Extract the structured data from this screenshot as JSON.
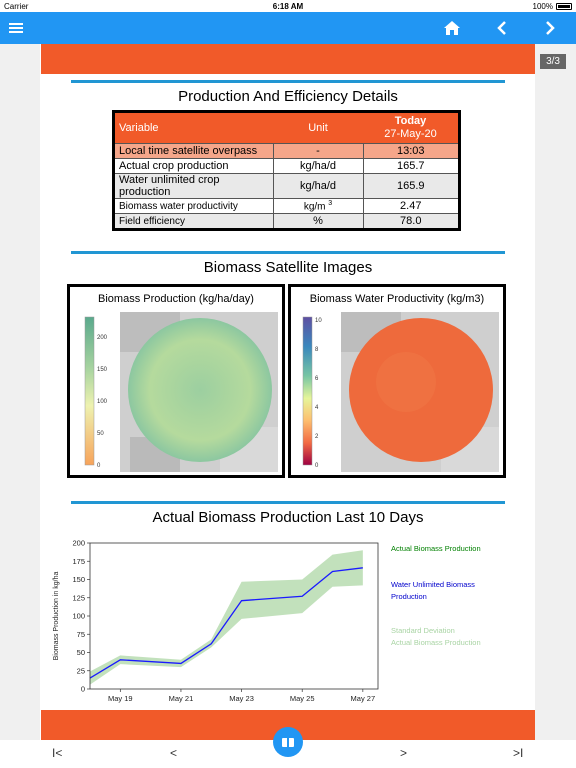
{
  "status_bar": {
    "carrier": "Carrier",
    "time": "6:18 AM",
    "battery": "100%"
  },
  "toolbar": {
    "menu_icon": "hamburger-icon",
    "home_icon": "home-icon",
    "prev_icon": "chevron-left-icon",
    "next_icon": "chevron-right-icon"
  },
  "page_badge": "3/3",
  "section1": {
    "title": "Production And Efficiency Details",
    "table": {
      "headers": {
        "variable": "Variable",
        "unit": "Unit",
        "today": "Today",
        "date": "27-May-20"
      },
      "rows": [
        {
          "variable": "Local time satellite overpass",
          "unit": "-",
          "value": "13:03"
        },
        {
          "variable": "Actual crop production",
          "unit": "kg/ha/d",
          "value": "165.7"
        },
        {
          "variable": "Water unlimited crop production",
          "unit": "kg/ha/d",
          "value": "165.9"
        },
        {
          "variable": "Biomass water productivity",
          "unit": "kg/m",
          "unit_sup": "3",
          "value": "2.47"
        },
        {
          "variable": "Field efficiency",
          "unit": "%",
          "value": "78.0"
        }
      ]
    }
  },
  "section2": {
    "title": "Biomass Satellite Images",
    "panel1": {
      "title": "Biomass Production (kg/ha/day)",
      "ticks": [
        "200",
        "150",
        "100",
        "50",
        "0"
      ]
    },
    "panel2": {
      "title": "Biomass Water Productivity (kg/m3)",
      "ticks": [
        "10",
        "8",
        "6",
        "4",
        "2",
        "0"
      ]
    }
  },
  "section3": {
    "title": "Actual Biomass Production Last 10 Days"
  },
  "colors": {
    "accent": "#2196f3",
    "orange": "#f15a29",
    "actual": "#1a1aff",
    "deviation": "#b7dcb0"
  },
  "chart_data": {
    "type": "line",
    "title": "Actual Biomass Production Last 10 Days",
    "ylabel": "Biomass Production in kg/ha",
    "xlabel": "",
    "ylim": [
      0,
      200
    ],
    "yticks": [
      "0",
      "25",
      "50",
      "75",
      "100",
      "125",
      "150",
      "175",
      "200"
    ],
    "x_tick_labels": [
      "May 19",
      "May 21",
      "May 23",
      "May 25",
      "May 27"
    ],
    "x": [
      18,
      19,
      21,
      22,
      23,
      25,
      26,
      27
    ],
    "series": [
      {
        "name": "Water Unlimited Biomass Production",
        "color": "#1a1aff",
        "values": [
          15,
          40,
          35,
          62,
          121,
          127,
          161,
          166
        ]
      },
      {
        "name": "Standard Deviation Actual Biomass Production",
        "color": "#b7dcb0",
        "band": true,
        "lower": [
          6,
          34,
          30,
          57,
          96,
          104,
          140,
          142
        ],
        "upper": [
          24,
          46,
          40,
          68,
          147,
          150,
          184,
          190
        ]
      }
    ],
    "legend": [
      "Actual Biomass Production",
      "Water Unlimited Biomass Production",
      "Standard Deviation Actual Biomass Production"
    ],
    "legend_position": "right",
    "grid": false
  },
  "legend_labels": {
    "actual": "Actual Biomass Production",
    "unlimited_1": "Water Unlimited Biomass",
    "unlimited_2": "Production",
    "std_1": "Standard Deviation",
    "std_2": "Actual Biomass Production"
  },
  "bottom_nav": {
    "first": "I<",
    "prev": "<",
    "next": ">",
    "last": ">I"
  }
}
